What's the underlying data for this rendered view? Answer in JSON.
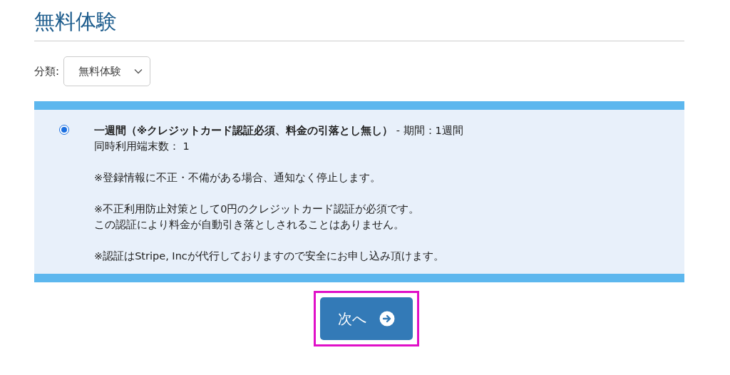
{
  "page_title": "無料体験",
  "category": {
    "label": "分類:",
    "value": "無料体験"
  },
  "plans": [
    {
      "selected": true,
      "heading": "**一週間（※クレジットカード認証必須、料金の引落とし無し）** - 期間：1週間",
      "paragraphs": [
        [
          "同時利用端末数： 1"
        ],
        [
          "※登録情報に不正・不備がある場合、通知なく停止します。"
        ],
        [
          "※不正利用防止対策として0円のクレジットカード認証が必須です。",
          "この認証により料金が自動引き落としされることはありません。"
        ],
        [
          "※認証はStripe, Incが代行しておりますので安全にお申し込み頂けます。"
        ]
      ]
    }
  ],
  "next_button": {
    "label": "次へ",
    "highlighted": true
  }
}
